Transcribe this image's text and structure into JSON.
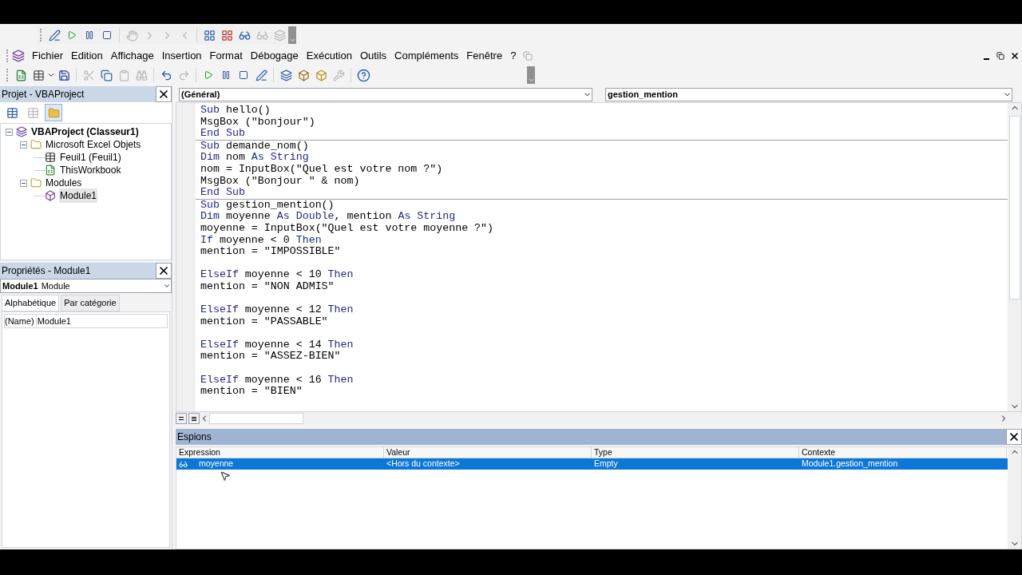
{
  "menu": [
    {
      "label": "Fichier"
    },
    {
      "label": "Edition"
    },
    {
      "label": "Affichage"
    },
    {
      "label": "Insertion"
    },
    {
      "label": "Format"
    },
    {
      "label": "Débogage"
    },
    {
      "label": "Exécution"
    },
    {
      "label": "Outils"
    },
    {
      "label": "Compléments"
    },
    {
      "label": "Fenêtre"
    },
    {
      "label": "?"
    }
  ],
  "project_pane": {
    "title": "Projet - VBAProject",
    "tree": [
      {
        "label": "VBAProject (Classeur1)",
        "kind": "project",
        "bold": true,
        "expanded": true,
        "selected": false,
        "children": [
          {
            "label": "Microsoft Excel Objets",
            "kind": "folder",
            "bold": false,
            "expanded": true,
            "selected": false,
            "children": [
              {
                "label": "Feuil1 (Feuil1)",
                "kind": "sheet",
                "bold": false,
                "selected": false
              },
              {
                "label": "ThisWorkbook",
                "kind": "workbook",
                "bold": false,
                "selected": false
              }
            ]
          },
          {
            "label": "Modules",
            "kind": "folder",
            "bold": false,
            "expanded": true,
            "selected": false,
            "children": [
              {
                "label": "Module1",
                "kind": "module",
                "bold": false,
                "selected": true
              }
            ]
          }
        ]
      }
    ]
  },
  "properties_pane": {
    "title": "Propriétés - Module1",
    "object_name": "Module1",
    "object_type": "Module",
    "tabs": [
      {
        "label": "Alphabétique",
        "selected": true
      },
      {
        "label": "Par catégorie",
        "selected": false
      }
    ],
    "rows": [
      {
        "name": "(Name)",
        "value": "Module1"
      }
    ]
  },
  "code_window": {
    "object_combo": "(Général)",
    "procedure_combo": "gestion_mention",
    "procedures": [
      {
        "lines": [
          {
            "segments": [
              {
                "kind": "keyword",
                "text": "Sub"
              },
              {
                "kind": "plain",
                "text": " hello()"
              }
            ]
          },
          {
            "segments": [
              {
                "kind": "plain",
                "text": "MsgBox (\"bonjour\")"
              }
            ]
          },
          {
            "segments": [
              {
                "kind": "keyword",
                "text": "End Sub"
              }
            ]
          }
        ]
      },
      {
        "lines": [
          {
            "segments": [
              {
                "kind": "keyword",
                "text": "Sub"
              },
              {
                "kind": "plain",
                "text": " demande_nom()"
              }
            ]
          },
          {
            "segments": [
              {
                "kind": "keyword",
                "text": "Dim"
              },
              {
                "kind": "plain",
                "text": " nom "
              },
              {
                "kind": "keyword",
                "text": "As String"
              }
            ]
          },
          {
            "segments": [
              {
                "kind": "plain",
                "text": "nom = InputBox(\"Quel est votre nom ?\")"
              }
            ]
          },
          {
            "segments": [
              {
                "kind": "plain",
                "text": "MsgBox (\"Bonjour \" & nom)"
              }
            ]
          },
          {
            "segments": [
              {
                "kind": "keyword",
                "text": "End Sub"
              }
            ]
          }
        ]
      },
      {
        "lines": [
          {
            "segments": [
              {
                "kind": "keyword",
                "text": "Sub"
              },
              {
                "kind": "plain",
                "text": " gestion_mention()"
              }
            ]
          },
          {
            "segments": [
              {
                "kind": "keyword",
                "text": "Dim"
              },
              {
                "kind": "plain",
                "text": " moyenne "
              },
              {
                "kind": "keyword",
                "text": "As Double"
              },
              {
                "kind": "plain",
                "text": ", mention "
              },
              {
                "kind": "keyword",
                "text": "As String"
              }
            ]
          },
          {
            "segments": [
              {
                "kind": "plain",
                "text": "moyenne = InputBox(\"Quel est votre moyenne ?\")"
              }
            ]
          },
          {
            "segments": [
              {
                "kind": "keyword",
                "text": "If"
              },
              {
                "kind": "plain",
                "text": " moyenne < 0 "
              },
              {
                "kind": "keyword",
                "text": "Then"
              }
            ]
          },
          {
            "segments": [
              {
                "kind": "plain",
                "text": "mention = \"IMPOSSIBLE\""
              }
            ],
            "blank_after": true
          },
          {
            "segments": [
              {
                "kind": "keyword",
                "text": "ElseIf"
              },
              {
                "kind": "plain",
                "text": " moyenne < 10 "
              },
              {
                "kind": "keyword",
                "text": "Then"
              }
            ]
          },
          {
            "segments": [
              {
                "kind": "plain",
                "text": "mention = \"NON ADMIS\""
              }
            ],
            "blank_after": true
          },
          {
            "segments": [
              {
                "kind": "keyword",
                "text": "ElseIf"
              },
              {
                "kind": "plain",
                "text": " moyenne < 12 "
              },
              {
                "kind": "keyword",
                "text": "Then"
              }
            ]
          },
          {
            "segments": [
              {
                "kind": "plain",
                "text": "mention = \"PASSABLE\""
              }
            ],
            "blank_after": true
          },
          {
            "segments": [
              {
                "kind": "keyword",
                "text": "ElseIf"
              },
              {
                "kind": "plain",
                "text": " moyenne < 14 "
              },
              {
                "kind": "keyword",
                "text": "Then"
              }
            ]
          },
          {
            "segments": [
              {
                "kind": "plain",
                "text": "mention = \"ASSEZ-BIEN\""
              }
            ],
            "blank_after": true
          },
          {
            "segments": [
              {
                "kind": "keyword",
                "text": "ElseIf"
              },
              {
                "kind": "plain",
                "text": " moyenne < 16 "
              },
              {
                "kind": "keyword",
                "text": "Then"
              }
            ]
          },
          {
            "segments": [
              {
                "kind": "plain",
                "text": "mention = \"BIEN\""
              }
            ]
          }
        ]
      }
    ]
  },
  "watch_pane": {
    "title": "Espions",
    "columns": [
      "Expression",
      "Valeur",
      "Type",
      "Contexte"
    ],
    "rows": [
      {
        "selected": true,
        "cells": [
          "moyenne",
          "<Hors du contexte>",
          "Empty",
          "Module1.gestion_mention"
        ]
      }
    ]
  }
}
